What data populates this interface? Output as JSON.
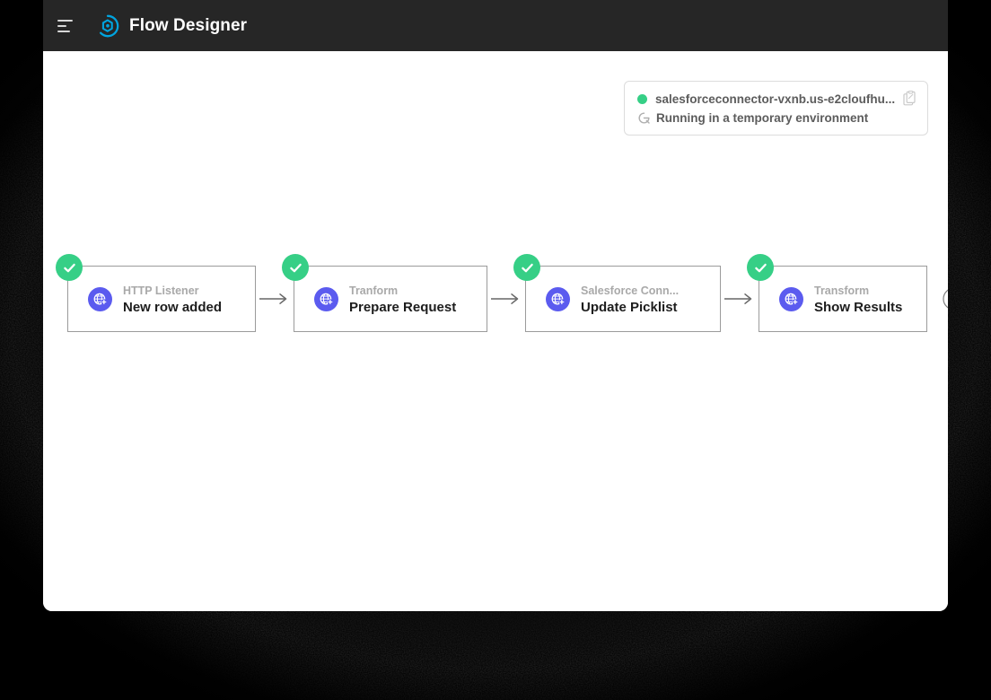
{
  "window": {
    "title": "Flow Designer"
  },
  "topbar": {
    "menu_icon": "hamburger-icon",
    "logo_icon": "mulesoft-logo-icon",
    "title": "Flow Designer",
    "logo_color": "#00a4df",
    "background": "#262626"
  },
  "status_panel": {
    "status_dot_color": "#36cf86",
    "environment_name": "salesforceconnector-vxnb.us-e2cloufhu...",
    "copy_icon": "copy-clipboard-icon",
    "temporary_icon": "temporary-environment-icon",
    "running_status": "Running in a temporary environment"
  },
  "flow": {
    "node_badge_color": "#36cf86",
    "node_icon_color": "#5b5bef",
    "add_step_icon": "plus-circle-icon",
    "nodes": [
      {
        "type": "HTTP Listener",
        "name": "New row added",
        "icon": "globe-icon",
        "status": "success"
      },
      {
        "type": "Tranform",
        "name": "Prepare Request",
        "icon": "globe-icon",
        "status": "success"
      },
      {
        "type": "Salesforce Conn...",
        "name": "Update Picklist",
        "icon": "globe-icon",
        "status": "success"
      },
      {
        "type": "Transform",
        "name": "Show Results",
        "icon": "globe-icon",
        "status": "success"
      }
    ]
  }
}
